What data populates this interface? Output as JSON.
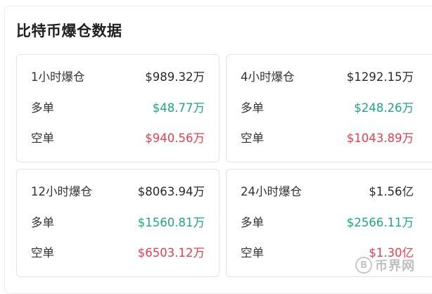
{
  "title": "比特币爆仓数据",
  "colors": {
    "long": "#1ba982",
    "short": "#ef3d4f",
    "text": "#2a2a2a"
  },
  "cards": [
    {
      "period_label": "1小时爆仓",
      "total": "$989.32万",
      "long_label": "多单",
      "long": "$48.77万",
      "short_label": "空单",
      "short": "$940.56万"
    },
    {
      "period_label": "4小时爆仓",
      "total": "$1292.15万",
      "long_label": "多单",
      "long": "$248.26万",
      "short_label": "空单",
      "short": "$1043.89万"
    },
    {
      "period_label": "12小时爆仓",
      "total": "$8063.94万",
      "long_label": "多单",
      "long": "$1560.81万",
      "short_label": "空单",
      "short": "$6503.12万"
    },
    {
      "period_label": "24小时爆仓",
      "total": "$1.56亿",
      "long_label": "多单",
      "long": "$2566.11万",
      "short_label": "空单",
      "short": "$1.30亿"
    }
  ],
  "watermark": {
    "logo_text": "B",
    "text": "币界网"
  }
}
